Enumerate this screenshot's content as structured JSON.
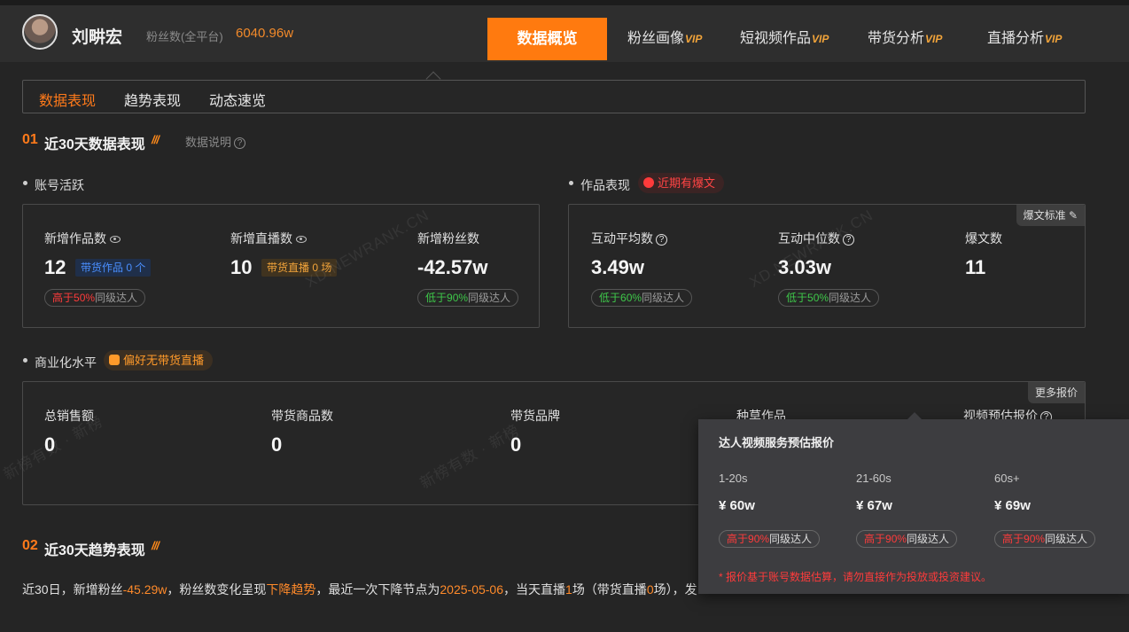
{
  "header": {
    "username": "刘畊宏",
    "fans_label": "粉丝数(全平台)",
    "fans_value": "6040.96w",
    "nav": {
      "overview": "数据概览",
      "fans_profile": "粉丝画像",
      "short_video": "短视频作品",
      "commerce": "带货分析",
      "live": "直播分析",
      "vip": "VIP"
    }
  },
  "subtabs": [
    "数据表现",
    "趋势表现",
    "动态速览"
  ],
  "section1": {
    "num": "01",
    "title": "近30天数据表现",
    "desc": "数据说明",
    "account": {
      "label": "账号活跃",
      "new_works": {
        "label": "新增作品数",
        "value": "12",
        "tag": "带货作品 0 个",
        "pill_pre": "高于",
        "pill_pct": "50%",
        "pill_post": "同级达人"
      },
      "new_lives": {
        "label": "新增直播数",
        "value": "10",
        "tag": "带货直播 0 场"
      },
      "new_fans": {
        "label": "新增粉丝数",
        "value": "-42.57w",
        "pill_pre": "低于",
        "pill_pct": "90%",
        "pill_post": "同级达人"
      }
    },
    "works": {
      "label": "作品表现",
      "badge": "近期有爆文",
      "corner": "爆文标准",
      "avg": {
        "label": "互动平均数",
        "value": "3.49w",
        "pill_pre": "低于",
        "pill_pct": "60%",
        "pill_post": "同级达人"
      },
      "median": {
        "label": "互动中位数",
        "value": "3.03w",
        "pill_pre": "低于",
        "pill_pct": "50%",
        "pill_post": "同级达人"
      },
      "viral": {
        "label": "爆文数",
        "value": "11"
      }
    },
    "commerce": {
      "label": "商业化水平",
      "badge": "偏好无带货直播",
      "corner": "更多报价",
      "sales": {
        "label": "总销售额",
        "value": "0"
      },
      "products": {
        "label": "带货商品数",
        "value": "0"
      },
      "brands": {
        "label": "带货品牌",
        "value": "0"
      },
      "seeding": {
        "label": "种草作品"
      },
      "video_price": {
        "label": "视频预估报价"
      }
    }
  },
  "section2": {
    "num": "02",
    "title": "近30天趋势表现",
    "text": {
      "p1": "近30日，新增粉丝",
      "fans": "-45.29w",
      "p2": "，粉丝数变化呈现",
      "trend": "下降趋势",
      "p3": "，最近一次下降节点为",
      "date": "2025-05-06",
      "p4": "，当天直播",
      "lives": "1",
      "p5": "场（带货直播",
      "sell_lives": "0",
      "p6": "场），发"
    }
  },
  "popup": {
    "title": "达人视频服务预估报价",
    "cols": [
      {
        "range": "1-20s",
        "price": "¥ 60w",
        "pill_pre": "高于",
        "pill_pct": "90%",
        "pill_post": "同级达人"
      },
      {
        "range": "21-60s",
        "price": "¥ 67w",
        "pill_pre": "高于",
        "pill_pct": "90%",
        "pill_post": "同级达人"
      },
      {
        "range": "60s+",
        "price": "¥ 69w",
        "pill_pre": "高于",
        "pill_pct": "90%",
        "pill_post": "同级达人"
      }
    ],
    "note": "* 报价基于账号数据估算，请勿直接作为投放或投资建议。"
  },
  "watermarks": [
    "XD.NEWRANK.CN",
    "新榜有数 · 新榜"
  ]
}
